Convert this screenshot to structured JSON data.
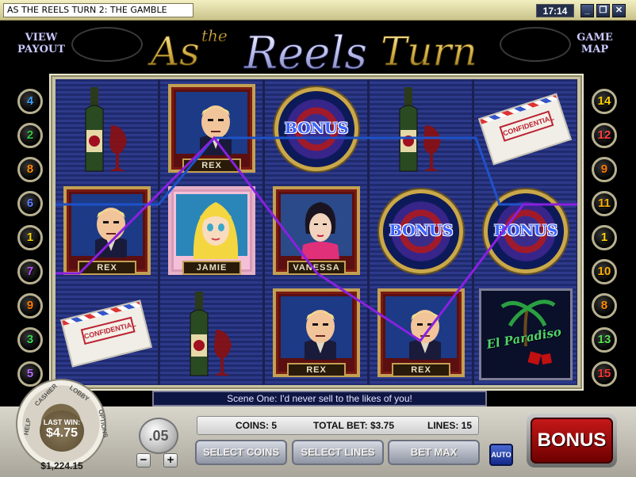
{
  "window": {
    "title": "AS THE REELS TURN 2: THE GAMBLE",
    "clock": "17:14",
    "buttons": [
      "minimize",
      "restore",
      "close"
    ]
  },
  "header": {
    "view_payout": "VIEW PAYOUT",
    "game_map": "GAME MAP",
    "logo_as": "As",
    "logo_the": "the",
    "logo_reels": "Reels",
    "logo_turn": "Turn"
  },
  "paylines": {
    "left": [
      "4",
      "2",
      "8",
      "6",
      "1",
      "7",
      "9",
      "3",
      "5"
    ],
    "right": [
      "14",
      "12",
      "9",
      "11",
      "1",
      "10",
      "8",
      "13",
      "15"
    ],
    "colors": [
      "#3aa0ff",
      "#2ecc40",
      "#ff8a00",
      "#5c7cff",
      "#ffd700",
      "#c14dff",
      "#ff7a00",
      "#33dd55",
      "#b36bff",
      "#ffd000",
      "#ffae00",
      "#ff4040",
      "#55e055",
      "#ffb000",
      "#ff3030"
    ]
  },
  "reels": [
    [
      {
        "symbol": "wine-bottle"
      },
      {
        "symbol": "rex",
        "label": "REX"
      },
      {
        "symbol": "confidential",
        "label": "CONFIDENTIAL"
      }
    ],
    [
      {
        "symbol": "rex",
        "label": "REX"
      },
      {
        "symbol": "jamie",
        "label": "JAMIE"
      },
      {
        "symbol": "wine-bottle"
      }
    ],
    [
      {
        "symbol": "bonus",
        "label": "BONUS"
      },
      {
        "symbol": "vanessa",
        "label": "VANESSA"
      },
      {
        "symbol": "rex",
        "label": "REX"
      }
    ],
    [
      {
        "symbol": "wine-bottle"
      },
      {
        "symbol": "bonus",
        "label": "BONUS"
      },
      {
        "symbol": "rex",
        "label": "REX"
      }
    ],
    [
      {
        "symbol": "confidential",
        "label": "CONFIDENTIAL"
      },
      {
        "symbol": "bonus",
        "label": "BONUS"
      },
      {
        "symbol": "el-paradiso",
        "label": "El Paradiso"
      }
    ]
  ],
  "scene_text": "Scene One: I'd never sell to the likes of you!",
  "dial": {
    "cashier": "CASHIER",
    "lobby": "LOBBY",
    "options": "OPTIONS",
    "help": "HELP",
    "last_win_label": "LAST WIN:",
    "last_win_value": "$4.75",
    "balance": "$1,224.15"
  },
  "coin_value": ".05",
  "info": {
    "coins": "COINS: 5",
    "total_bet": "TOTAL BET: $3.75",
    "lines": "LINES: 15"
  },
  "controls": {
    "select_coins": "SELECT COINS",
    "select_lines": "SELECT LINES",
    "bet_max": "BET MAX",
    "auto": "AUTO",
    "bonus": "BONUS",
    "minus": "−",
    "plus": "+"
  }
}
